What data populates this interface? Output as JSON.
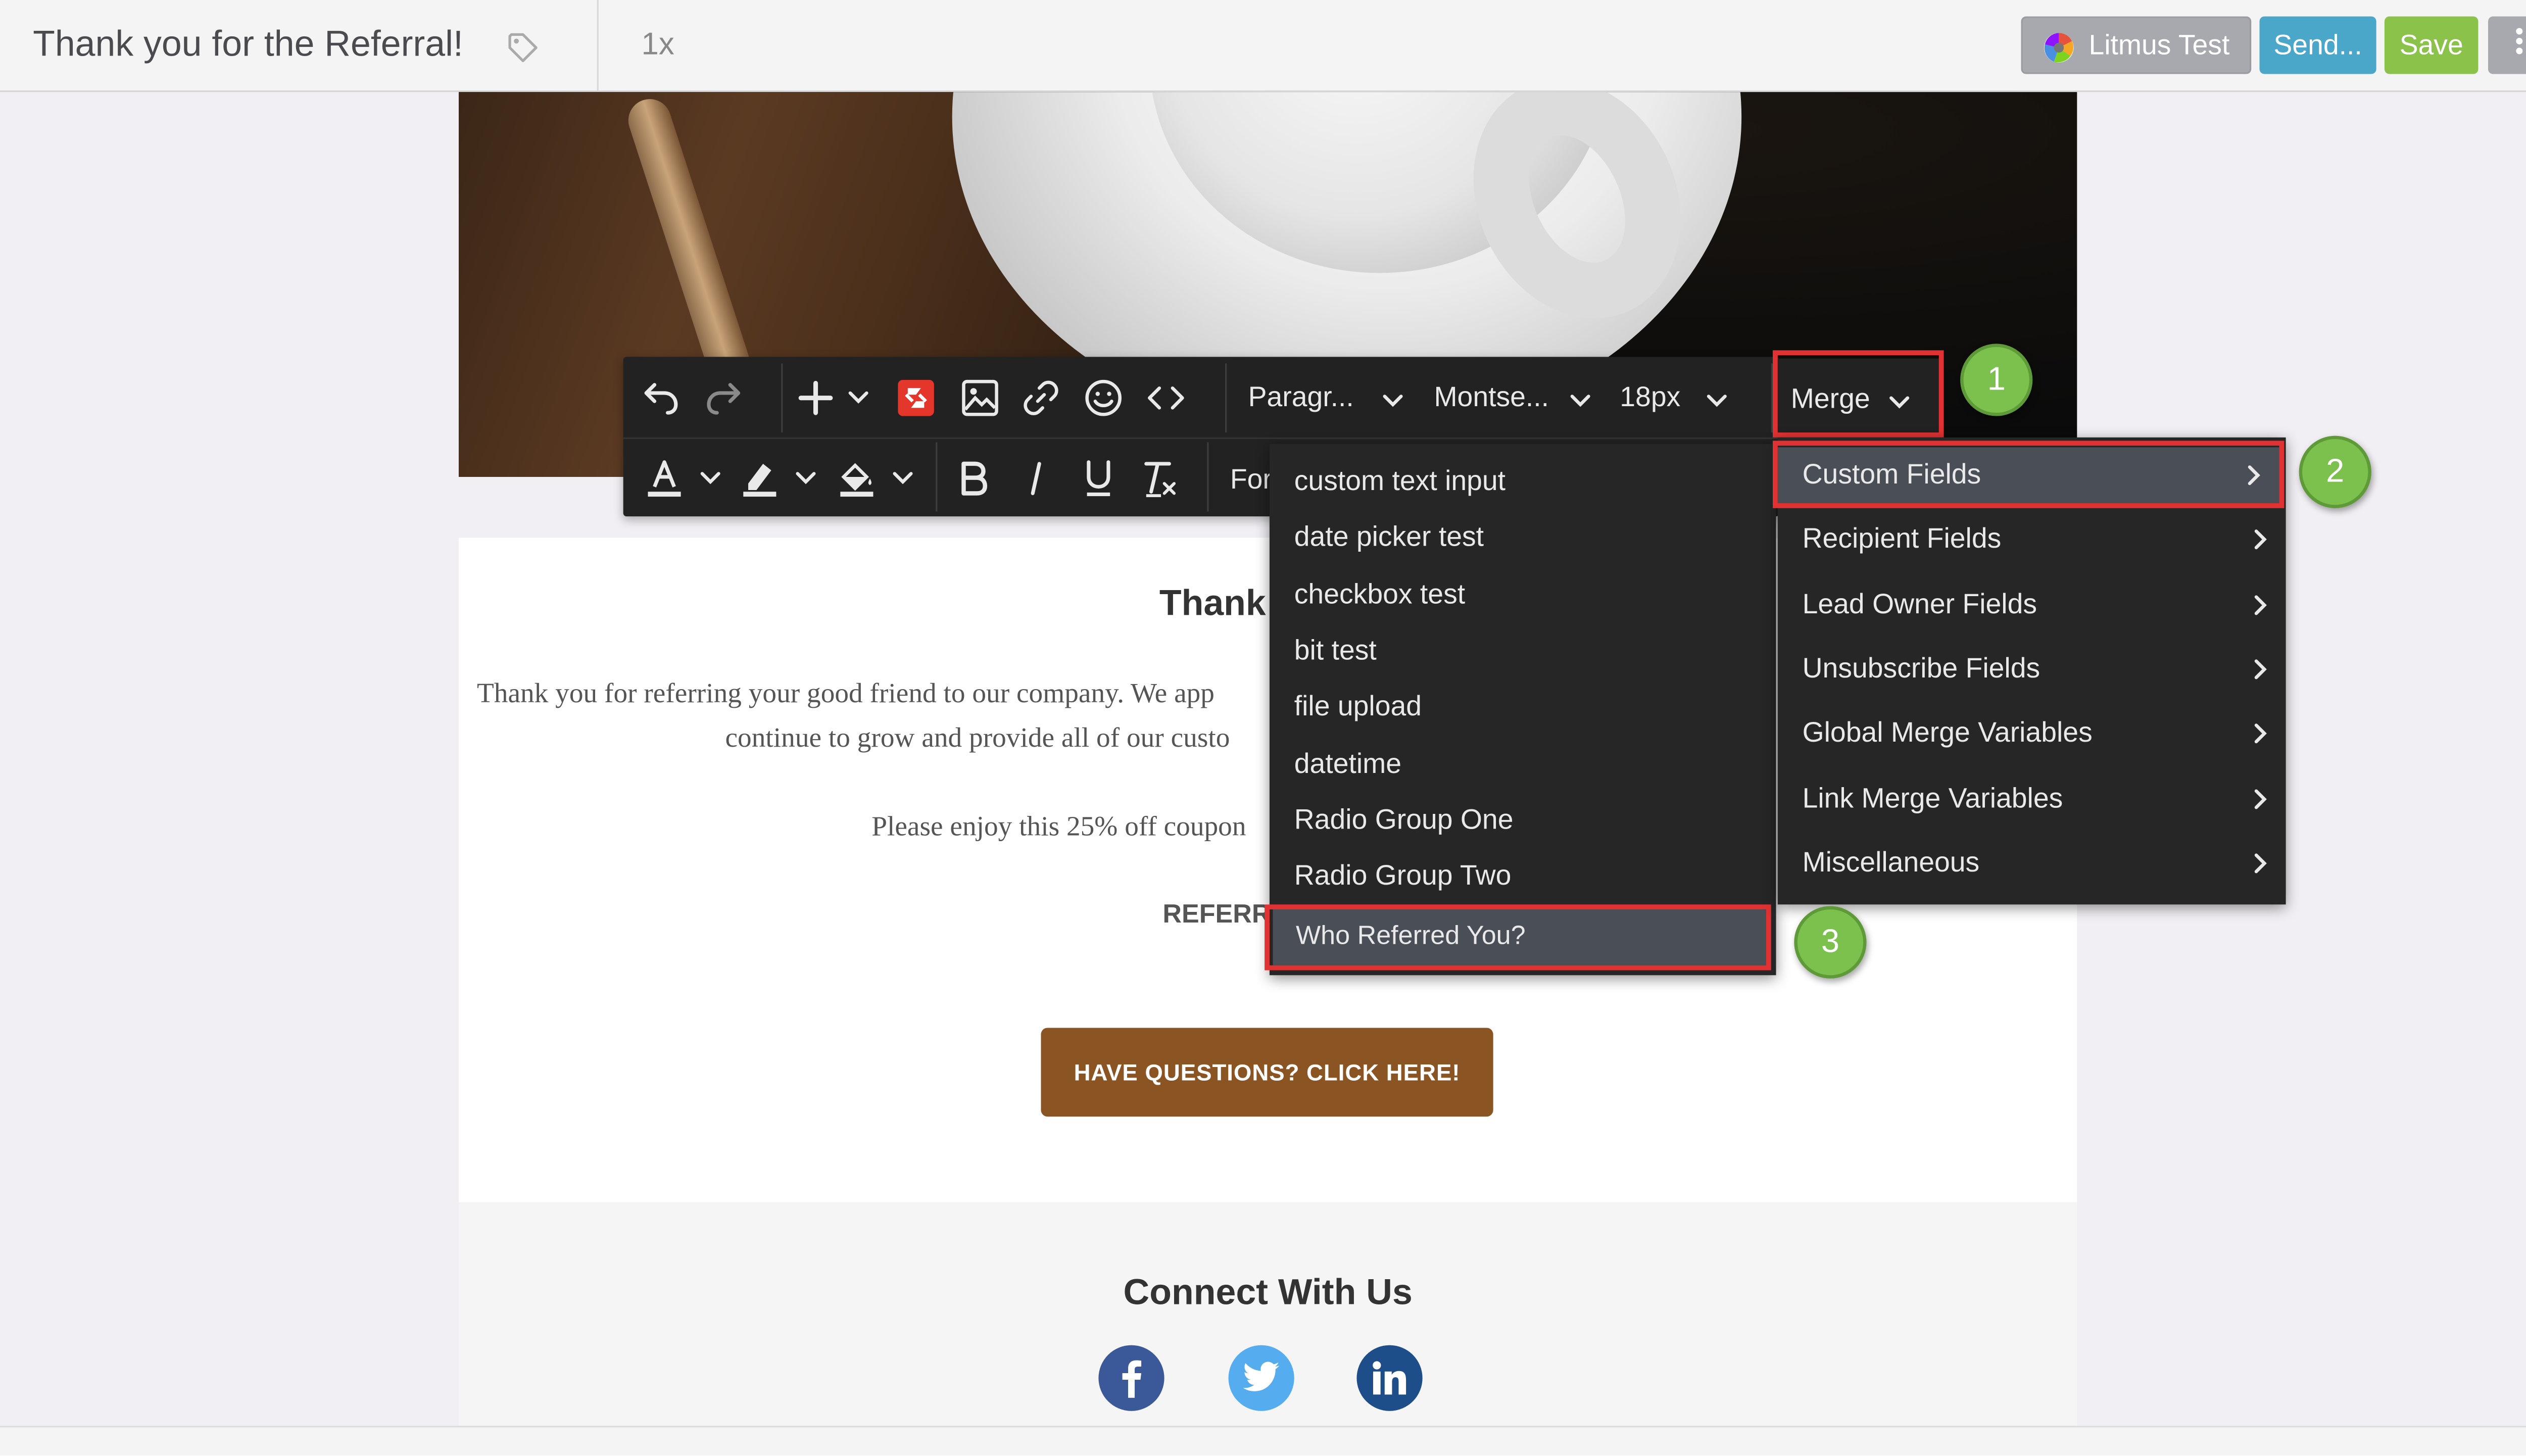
{
  "header": {
    "title": "Thank you for the Referral!",
    "zoom": "1x",
    "buttons": {
      "litmus": "Litmus Test",
      "send": "Send...",
      "save": "Save"
    }
  },
  "email": {
    "heading": "Thank",
    "line1": "Thank you for referring your good friend to our company. We app",
    "line2": "continue to grow and provide all of our custo",
    "line3": "Please enjoy this 25% off coupon",
    "code_label": "REFERR",
    "cta": "HAVE QUESTIONS? CLICK HERE!",
    "connect": "Connect With Us"
  },
  "toolbar": {
    "paragraph": "Paragr...",
    "font": "Montse...",
    "size": "18px",
    "merge": "Merge",
    "format": "For"
  },
  "merge_menu": [
    {
      "label": "Custom Fields",
      "selected": true
    },
    {
      "label": "Recipient Fields"
    },
    {
      "label": "Lead Owner Fields"
    },
    {
      "label": "Unsubscribe Fields"
    },
    {
      "label": "Global Merge Variables"
    },
    {
      "label": "Link Merge Variables"
    },
    {
      "label": "Miscellaneous"
    }
  ],
  "custom_fields_menu": [
    {
      "label": "custom text input"
    },
    {
      "label": "date picker test"
    },
    {
      "label": "checkbox test"
    },
    {
      "label": "bit test"
    },
    {
      "label": "file upload"
    },
    {
      "label": "datetime"
    },
    {
      "label": "Radio Group One"
    },
    {
      "label": "Radio Group Two"
    },
    {
      "label": "Who Referred You?",
      "selected": true
    }
  ],
  "callouts": [
    "1",
    "2",
    "3"
  ],
  "colors": {
    "accent_red": "#e03232",
    "callout_green": "#7cc04e",
    "send_blue": "#4aa7c9",
    "save_green": "#8bc34a",
    "cta_brown": "#8b5423"
  }
}
